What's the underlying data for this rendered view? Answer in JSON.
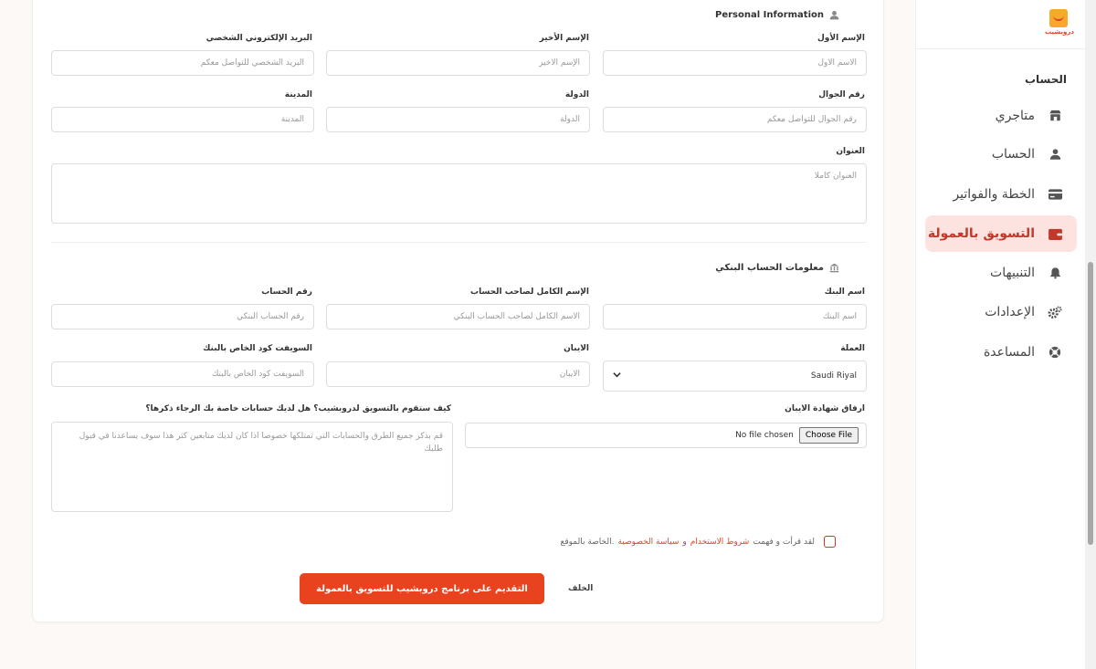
{
  "sidebar": {
    "logo_text": "دروبشيب",
    "heading": "الحساب",
    "items": [
      {
        "label": "متاجري",
        "icon": "store-icon"
      },
      {
        "label": "الحساب",
        "icon": "user-icon"
      },
      {
        "label": "الخطة والفواتير",
        "icon": "credit-card-icon"
      },
      {
        "label": "التسويق بالعمولة",
        "icon": "wallet-icon",
        "active": true
      },
      {
        "label": "التنبيهات",
        "icon": "bell-icon"
      },
      {
        "label": "الإعدادات",
        "icon": "gears-icon"
      },
      {
        "label": "المساعدة",
        "icon": "lifebuoy-icon"
      }
    ]
  },
  "personal": {
    "title": "Personal Information",
    "first_name": {
      "label": "الإسم الأول",
      "placeholder": "الاسم الأول"
    },
    "last_name": {
      "label": "الإسم الأخير",
      "placeholder": "الإسم الأخير"
    },
    "email": {
      "label": "البريد الإلكتروني الشخصي",
      "placeholder": "البريد الشخصي للتواصل معكم"
    },
    "phone": {
      "label": "رقم الجوال",
      "placeholder": "رقم الجوال للتواصل معكم"
    },
    "country": {
      "label": "الدولة",
      "placeholder": "الدولة"
    },
    "city": {
      "label": "المدينة",
      "placeholder": "المدينة"
    },
    "address": {
      "label": "العنوان",
      "placeholder": "العنوان كاملا"
    }
  },
  "bank": {
    "title": "معلومات الحساب البنكي",
    "bank_name": {
      "label": "اسم البنك",
      "placeholder": "اسم البنك"
    },
    "holder_name": {
      "label": "الإسم الكامل لصاحب الحساب",
      "placeholder": "الاسم الكامل لصاحب الحساب البنكي"
    },
    "account_number": {
      "label": "رقم الحساب",
      "placeholder": "رقم الحساب البنكي"
    },
    "currency": {
      "label": "العملة",
      "value": "Saudi Riyal"
    },
    "iban": {
      "label": "الايبان",
      "placeholder": "الايبان"
    },
    "swift": {
      "label": "السويفت كود الخاص بالبنك",
      "placeholder": "السويفت كود الخاص بالبنك"
    },
    "iban_cert": {
      "label": "ارفاق شهادة الايبان",
      "button": "Choose File",
      "status": "No file chosen"
    },
    "marketing": {
      "label": "كيف ستقوم بالتسويق لدروبشيب؟ هل لديك حسابات خاصة بك الرجاء ذكرها؟",
      "placeholder": "قم بذكر جميع الطرق والحسابات التي تمتلكها خصوصا اذا كان لديك متابعين كثر هذا سوف يساعدنا في قبول طلبك"
    }
  },
  "terms": {
    "prefix": "لقد قرأت و فهمت",
    "terms_link": "شروط الاستخدام",
    "and": "و",
    "privacy_link": "سياسة الخصوصية",
    "suffix": "الخاصة بالموقع."
  },
  "actions": {
    "submit": "التقديم على برنامج دروبشيب للتسويق بالعمولة",
    "back": "الخلف"
  }
}
